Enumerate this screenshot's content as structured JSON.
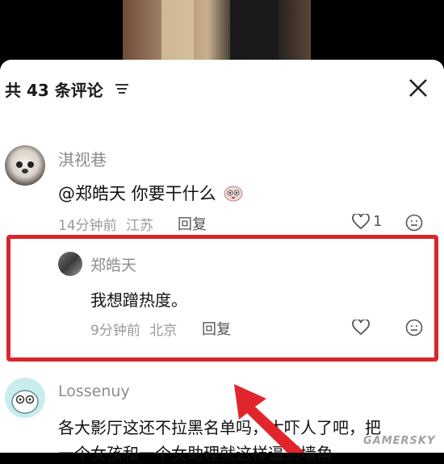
{
  "header": {
    "title": "共 43 条评论"
  },
  "comments": [
    {
      "user": "淇视巷",
      "text": "@郑皓天 你要干什么",
      "time": "14分钟前",
      "location": "江苏",
      "reply_label": "回复",
      "likes": "1"
    },
    {
      "user": "郑皓天",
      "text": "我想蹭热度。",
      "time": "9分钟前",
      "location": "北京",
      "reply_label": "回复"
    },
    {
      "user": "Lossenuy",
      "text_line1": "各大影厅这还不拉黑名单吗，太吓人了吧，把",
      "text_line2": "一个女孩和一个女助理就这样逼到墙角"
    }
  ],
  "watermark": "GAMERSKY",
  "colors": {
    "highlight": "#d8262b",
    "text": "#111111",
    "meta": "#9a9a9a"
  }
}
